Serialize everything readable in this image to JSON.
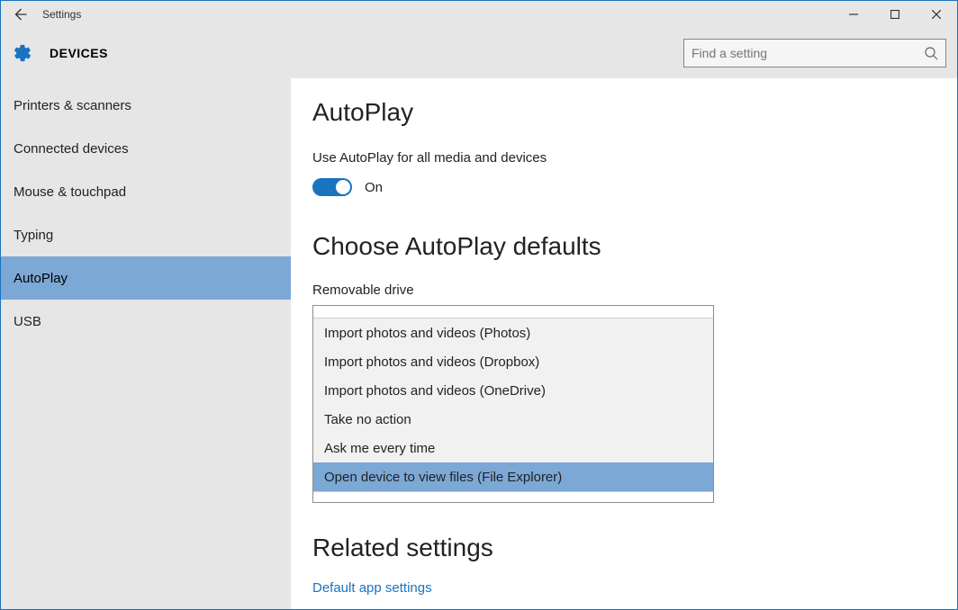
{
  "window": {
    "title": "Settings"
  },
  "header": {
    "category": "DEVICES",
    "search_placeholder": "Find a setting"
  },
  "sidebar": {
    "items": [
      {
        "label": "Printers & scanners",
        "selected": false
      },
      {
        "label": "Connected devices",
        "selected": false
      },
      {
        "label": "Mouse & touchpad",
        "selected": false
      },
      {
        "label": "Typing",
        "selected": false
      },
      {
        "label": "AutoPlay",
        "selected": true
      },
      {
        "label": "USB",
        "selected": false
      }
    ]
  },
  "main": {
    "title": "AutoPlay",
    "autoplay_desc": "Use AutoPlay for all media and devices",
    "toggle_state": "On",
    "defaults_heading": "Choose AutoPlay defaults",
    "removable_label": "Removable drive",
    "dropdown_options": [
      "Import photos and videos (Photos)",
      "Import photos and videos (Dropbox)",
      "Import photos and videos (OneDrive)",
      "Take no action",
      "Ask me every time",
      "Open device to view files (File Explorer)"
    ],
    "dropdown_selected_index": 5,
    "related_heading": "Related settings",
    "related_link": "Default app settings"
  }
}
